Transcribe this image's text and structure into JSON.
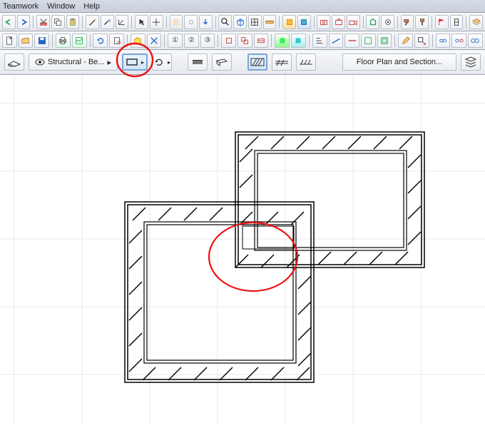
{
  "menu": {
    "teamwork": "Teamwork",
    "window": "Window",
    "help": "Help"
  },
  "toolbar3": {
    "layer_label": "Structural - Be...",
    "floorplan_label": "Floor Plan and Section..."
  },
  "icons": {
    "undo": "undo-icon",
    "redo": "redo-icon",
    "cut": "cut-icon",
    "pick": "pick-icon",
    "wand": "wand-icon",
    "spray": "spray-icon",
    "cross": "cross-icon",
    "sun": "sun-icon",
    "dim": "dim-icon",
    "rect": "rect-icon",
    "poly": "poly-icon",
    "line": "line-icon",
    "arc": "arc-icon"
  }
}
